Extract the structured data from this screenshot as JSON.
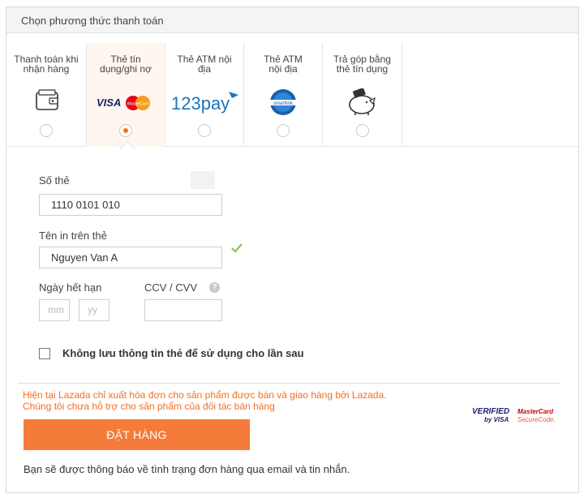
{
  "header": {
    "title": "Chọn phương thức thanh toán"
  },
  "tabs": [
    {
      "label": "Thanh toán khi nhận hàng",
      "icon": "wallet-icon",
      "selected": false
    },
    {
      "label": "Thẻ tín dụng/ghi nợ",
      "icon": "visa-mastercard-icon",
      "selected": true,
      "brand_visa": "VISA",
      "brand_mc": "MasterCard"
    },
    {
      "label": "Thẻ ATM nội địa",
      "icon": "123pay-icon",
      "selected": false,
      "brand": "123pay"
    },
    {
      "label": "Thẻ ATM nội địa",
      "icon": "smartlink-icon",
      "selected": false,
      "brand": "smartlink"
    },
    {
      "label": "Trả góp bằng thẻ tín dụng",
      "icon": "piggy-bank-icon",
      "selected": false
    }
  ],
  "form": {
    "card_number_label": "Số thẻ",
    "card_number_value": "1110 0101 010",
    "name_label": "Tên in trên thẻ",
    "name_value": "Nguyen Van A",
    "expiry_label": "Ngày hết hạn",
    "expiry_mm_placeholder": "mm",
    "expiry_yy_placeholder": "yy",
    "cvv_label": "CCV / CVV",
    "cvv_help": "?",
    "save_checkbox_label": "Không lưu thông tin thẻ để sử dụng cho lần sau",
    "save_checked": false
  },
  "notice": {
    "line1": "Hiện tại Lazada chỉ xuất hóa đơn cho sản phẩm được bán và giao hàng bởi Lazada.",
    "line2": "Chúng tôi chưa hỗ trợ cho sản phẩm của đối tác bán hàng"
  },
  "security_logos": {
    "verified": "VERIFIED",
    "by_visa": "by VISA",
    "mastercard": "MasterCard",
    "securecode": "SecureCode."
  },
  "order_button": "ĐẶT HÀNG",
  "footer_note": "Bạn sẽ được thông báo về tình trạng đơn hàng qua email và tin nhắn.",
  "colors": {
    "accent": "#f36f21",
    "button": "#f47b3a",
    "check": "#8cc152"
  }
}
